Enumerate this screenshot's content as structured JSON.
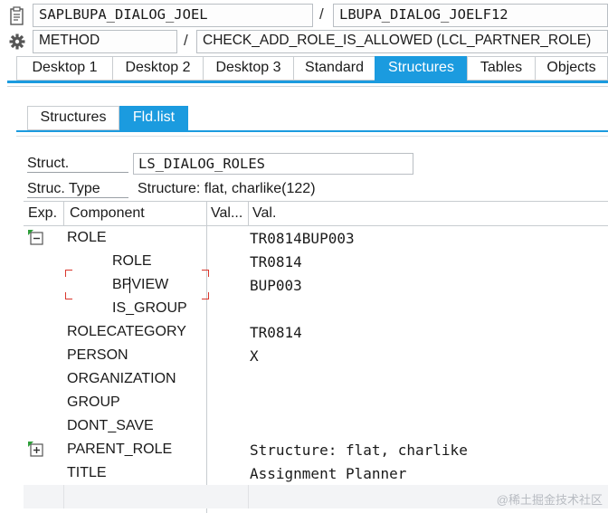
{
  "header": {
    "program": "SAPLBUPA_DIALOG_JOEL",
    "include": "LBUPA_DIALOG_JOELF12",
    "event_type": "METHOD",
    "event_name": "CHECK_ADD_ROLE_IS_ALLOWED (LCL_PARTNER_ROLE)",
    "separator": "/"
  },
  "main_tabs": [
    {
      "label": "Desktop 1",
      "active": false
    },
    {
      "label": "Desktop 2",
      "active": false
    },
    {
      "label": "Desktop 3",
      "active": false
    },
    {
      "label": "Standard",
      "active": false
    },
    {
      "label": "Structures",
      "active": true
    },
    {
      "label": "Tables",
      "active": false
    },
    {
      "label": "Objects",
      "active": false
    }
  ],
  "sub_tabs": [
    {
      "label": "Structures",
      "active": false
    },
    {
      "label": "Fld.list",
      "active": true
    }
  ],
  "struct": {
    "label": "Struct.",
    "value": "LS_DIALOG_ROLES",
    "type_label": "Struc. Type",
    "type_value": "Structure: flat, charlike(122)"
  },
  "table": {
    "headers": [
      "Exp.",
      "Component",
      "Val...",
      "Val."
    ],
    "rows": [
      {
        "component": "ROLE",
        "value": "TR0814BUP003",
        "indent": 0,
        "icon": "collapse-icon"
      },
      {
        "component": "ROLE",
        "value": "TR0814",
        "indent": 1,
        "icon": ""
      },
      {
        "component": "BPVIEW",
        "value": "BUP003",
        "indent": 1,
        "icon": ""
      },
      {
        "component": "IS_GROUP",
        "value": "",
        "indent": 1,
        "icon": ""
      },
      {
        "component": "ROLECATEGORY",
        "value": "TR0814",
        "indent": 0,
        "icon": ""
      },
      {
        "component": "PERSON",
        "value": "X",
        "indent": 0,
        "icon": ""
      },
      {
        "component": "ORGANIZATION",
        "value": "",
        "indent": 0,
        "icon": ""
      },
      {
        "component": "GROUP",
        "value": "",
        "indent": 0,
        "icon": ""
      },
      {
        "component": "DONT_SAVE",
        "value": "",
        "indent": 0,
        "icon": ""
      },
      {
        "component": "PARENT_ROLE",
        "value": "Structure: flat, charlike",
        "indent": 0,
        "icon": "expand-icon"
      },
      {
        "component": "TITLE",
        "value": "Assignment Planner",
        "indent": 0,
        "icon": ""
      }
    ]
  },
  "watermark": "@稀土掘金技术社区",
  "colors": {
    "accent": "#1b9bdf",
    "selection": "#d9372d"
  }
}
